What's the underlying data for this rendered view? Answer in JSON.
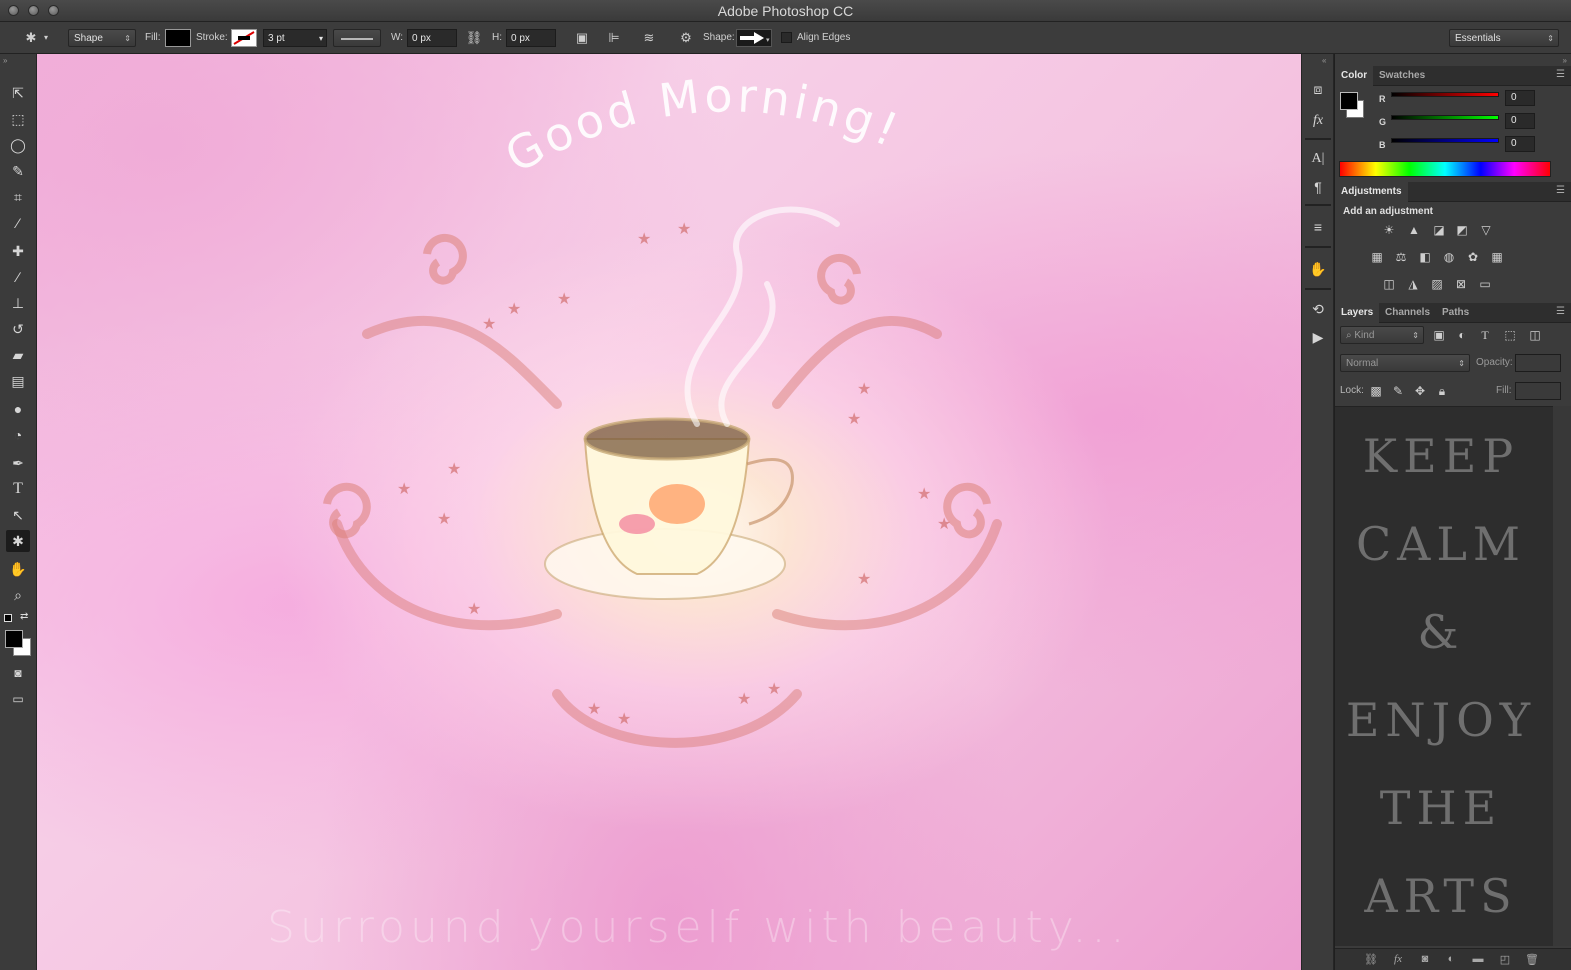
{
  "window": {
    "title": "Adobe Photoshop CC"
  },
  "options_bar": {
    "tool_mode": "Shape",
    "fill_label": "Fill:",
    "stroke_label": "Stroke:",
    "stroke_width": "3 pt",
    "w_label": "W:",
    "w_value": "0 px",
    "h_label": "H:",
    "h_value": "0 px",
    "shape_label": "Shape:",
    "align_edges_label": "Align Edges",
    "align_edges_checked": false,
    "workspace": "Essentials"
  },
  "toolbar": {
    "tools": [
      "move-tool",
      "marquee-tool",
      "lasso-tool",
      "quick-selection-tool",
      "crop-tool",
      "eyedropper-tool",
      "healing-brush-tool",
      "brush-tool",
      "clone-stamp-tool",
      "history-brush-tool",
      "eraser-tool",
      "gradient-tool",
      "blur-tool",
      "dodge-tool",
      "pen-tool",
      "type-tool",
      "path-selection-tool",
      "custom-shape-tool",
      "hand-tool",
      "zoom-tool"
    ],
    "active_tool": "custom-shape-tool",
    "foreground_color": "#000000",
    "background_color": "#ffffff"
  },
  "canvas": {
    "heading": "Good Morning!",
    "tagline": "Surround yourself with beauty..."
  },
  "color_panel": {
    "tabs": [
      "Color",
      "Swatches"
    ],
    "active_tab": "Color",
    "r_label": "R",
    "r_value": "0",
    "g_label": "G",
    "g_value": "0",
    "b_label": "B",
    "b_value": "0"
  },
  "adjustments_panel": {
    "tab": "Adjustments",
    "subtitle": "Add an adjustment"
  },
  "layers_panel": {
    "tabs": [
      "Layers",
      "Channels",
      "Paths"
    ],
    "active_tab": "Layers",
    "filter_kind": "Kind",
    "blend_mode": "Normal",
    "opacity_label": "Opacity:",
    "lock_label": "Lock:",
    "fill_label": "Fill:"
  },
  "layer_preview_text": [
    "KEEP",
    "CALM",
    "&",
    "ENJOY",
    "THE",
    "ARTS"
  ]
}
